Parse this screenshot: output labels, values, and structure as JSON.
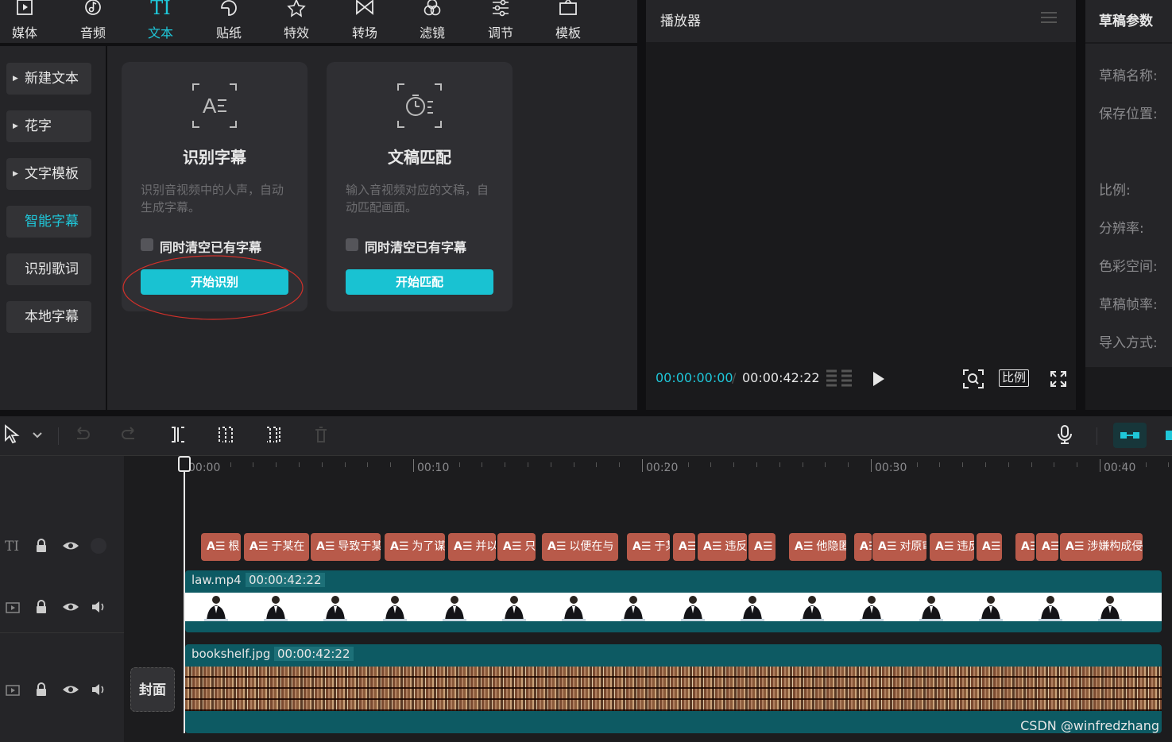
{
  "nav": {
    "items": [
      {
        "label": "媒体",
        "icon": "media-icon"
      },
      {
        "label": "音频",
        "icon": "audio-icon"
      },
      {
        "label": "文本",
        "icon": "text-icon",
        "active": true
      },
      {
        "label": "贴纸",
        "icon": "sticker-icon"
      },
      {
        "label": "特效",
        "icon": "effects-icon"
      },
      {
        "label": "转场",
        "icon": "transition-icon"
      },
      {
        "label": "滤镜",
        "icon": "filter-icon"
      },
      {
        "label": "调节",
        "icon": "adjust-icon"
      },
      {
        "label": "模板",
        "icon": "template-icon"
      }
    ],
    "text_icon_glyph": "TI"
  },
  "sidebar": {
    "items": [
      {
        "label": "新建文本",
        "expandable": true
      },
      {
        "label": "花字",
        "expandable": true
      },
      {
        "label": "文字模板",
        "expandable": true
      },
      {
        "label": "智能字幕",
        "active": true
      },
      {
        "label": "识别歌词"
      },
      {
        "label": "本地字幕"
      }
    ]
  },
  "cards": [
    {
      "title": "识别字幕",
      "desc": "识别音视频中的人声，自动生成字幕。",
      "checkbox": "同时清空已有字幕",
      "button": "开始识别",
      "icon": "speech-recognize-icon"
    },
    {
      "title": "文稿匹配",
      "desc": "输入音视频对应的文稿，自动匹配画面。",
      "checkbox": "同时清空已有字幕",
      "button": "开始匹配",
      "icon": "script-match-icon"
    }
  ],
  "player": {
    "title": "播放器",
    "current_time": "00:00:00:00",
    "total_time": "00:00:42:22",
    "ratio_label": "比例"
  },
  "draft": {
    "title": "草稿参数",
    "fields": [
      "草稿名称:",
      "保存位置:",
      "比例:",
      "分辨率:",
      "色彩空间:",
      "草稿帧率:",
      "导入方式:"
    ]
  },
  "timeline": {
    "ruler_labels": [
      "00:00",
      "00:10",
      "00:20",
      "00:30",
      "00:40"
    ],
    "subtitle_icon": "A☰",
    "subtitles": [
      "根",
      "于某在",
      "导致于某",
      "为了谋",
      "并以",
      "只",
      "以便在与",
      "于某",
      "",
      "违反",
      "",
      "他隐匿",
      "",
      "对原审",
      "违反",
      "",
      "",
      "",
      "涉嫌构成侵"
    ],
    "video_clip": {
      "name": "law.mp4",
      "duration": "00:00:42:22"
    },
    "image_clip": {
      "name": "bookshelf.jpg",
      "duration": "00:00:42:22"
    },
    "cover_label": "封面",
    "text_track_label": "TI"
  },
  "watermark": "CSDN @winfredzhang",
  "colors": {
    "accent": "#1fc7d9",
    "subtitle": "#b85a4a",
    "clip": "#0d5a63",
    "annotation": "#d0302a"
  }
}
